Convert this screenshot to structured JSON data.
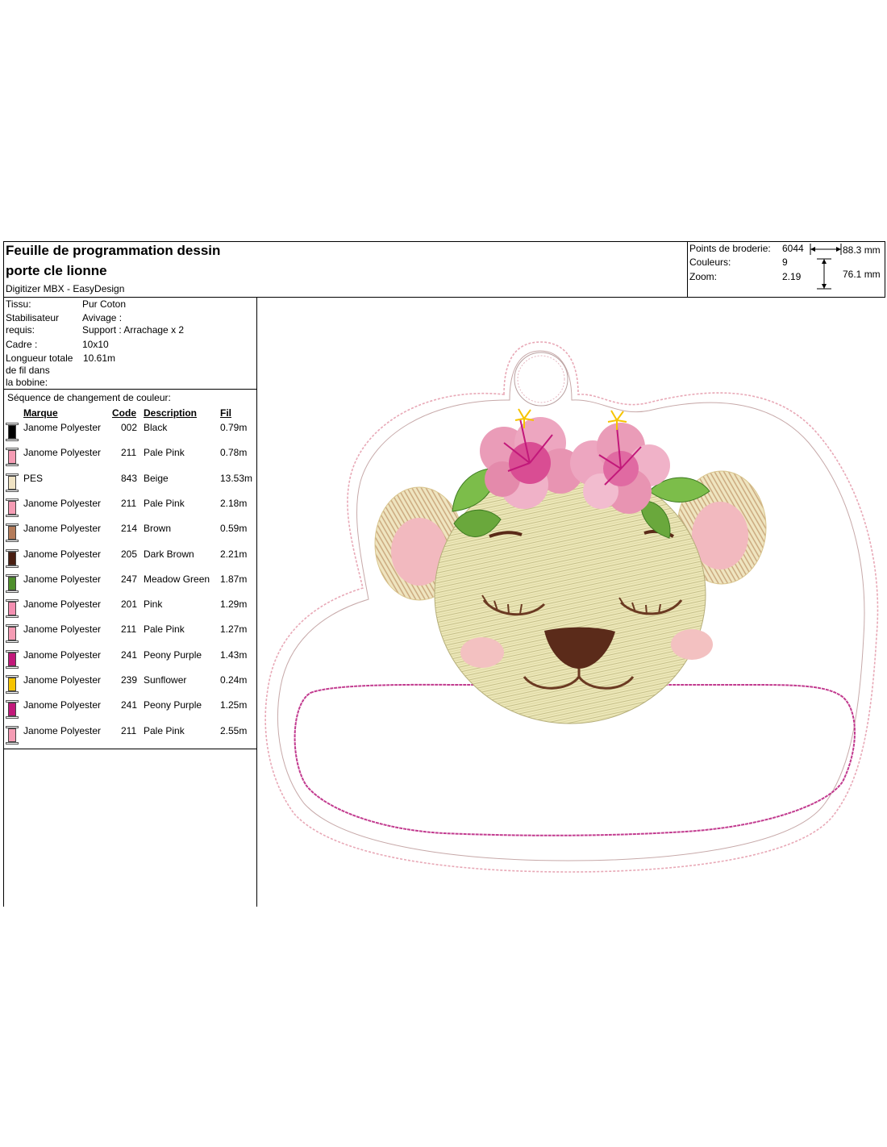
{
  "header": {
    "title_line1": "Feuille de programmation dessin",
    "title_line2": "porte cle lionne",
    "software": "Digitizer MBX - EasyDesign"
  },
  "stats": {
    "points_label": "Points de broderie:",
    "points_value": "6044",
    "colors_label": "Couleurs:",
    "colors_value": "9",
    "zoom_label": "Zoom:",
    "zoom_value": "2.19",
    "width_value": "88.3 mm",
    "height_value": "76.1 mm"
  },
  "info": {
    "tissu_label": "Tissu:",
    "tissu_value": "Pur Coton",
    "stab_label_1": "Stabilisateur",
    "stab_label_2": "requis:",
    "stab_value_1": "Avivage :",
    "stab_value_2": "Support : Arrachage x 2",
    "cadre_label": "Cadre :",
    "cadre_value": "10x10",
    "longueur_label_1": "Longueur totale",
    "longueur_label_2": "de fil dans",
    "longueur_label_3": "la bobine:",
    "longueur_value": "10.61m"
  },
  "sequence": {
    "heading": "Séquence de changement de couleur:",
    "columns": {
      "brand": "Marque",
      "code": "Code",
      "description": "Description",
      "thread": "Fil"
    },
    "rows": [
      {
        "brand": "Janome Polyester",
        "code": "002",
        "description": "Black",
        "thread": "0.79m",
        "color": "#000000"
      },
      {
        "brand": "Janome Polyester",
        "code": "211",
        "description": "Pale Pink",
        "thread": "0.78m",
        "color": "#f59cb4"
      },
      {
        "brand": "PES",
        "code": "843",
        "description": "Beige",
        "thread": "13.53m",
        "color": "#f0e3c4"
      },
      {
        "brand": "Janome Polyester",
        "code": "211",
        "description": "Pale Pink",
        "thread": "2.18m",
        "color": "#f59cb4"
      },
      {
        "brand": "Janome Polyester",
        "code": "214",
        "description": "Brown",
        "thread": "0.59m",
        "color": "#b47b5a"
      },
      {
        "brand": "Janome Polyester",
        "code": "205",
        "description": "Dark Brown",
        "thread": "2.21m",
        "color": "#4a1f12"
      },
      {
        "brand": "Janome Polyester",
        "code": "247",
        "description": "Meadow Green",
        "thread": "1.87m",
        "color": "#4f8f2c"
      },
      {
        "brand": "Janome Polyester",
        "code": "201",
        "description": "Pink",
        "thread": "1.29m",
        "color": "#f48fb1"
      },
      {
        "brand": "Janome Polyester",
        "code": "211",
        "description": "Pale Pink",
        "thread": "1.27m",
        "color": "#f59cb4"
      },
      {
        "brand": "Janome Polyester",
        "code": "241",
        "description": "Peony Purple",
        "thread": "1.43m",
        "color": "#c2187a"
      },
      {
        "brand": "Janome Polyester",
        "code": "239",
        "description": "Sunflower",
        "thread": "0.24m",
        "color": "#f6c400"
      },
      {
        "brand": "Janome Polyester",
        "code": "241",
        "description": "Peony Purple",
        "thread": "1.25m",
        "color": "#c2187a"
      },
      {
        "brand": "Janome Polyester",
        "code": "211",
        "description": "Pale Pink",
        "thread": "2.55m",
        "color": "#f59cb4"
      }
    ]
  }
}
